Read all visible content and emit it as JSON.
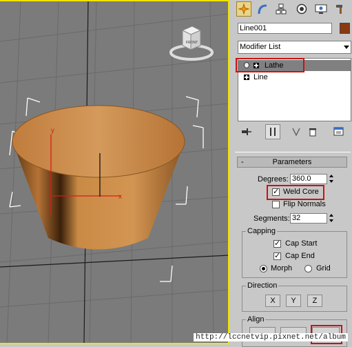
{
  "viewport": {
    "viewcube_face": "FRONT",
    "axis_y_label": "y",
    "axis_x_label": "x",
    "object_color": "#b57335",
    "border_color": "#f0e400"
  },
  "command_panel": {
    "tabs": [
      {
        "name": "create",
        "icon": "sparkle-icon"
      },
      {
        "name": "modify",
        "icon": "bend-icon"
      },
      {
        "name": "hierarchy",
        "icon": "hierarchy-icon"
      },
      {
        "name": "motion",
        "icon": "motion-icon"
      },
      {
        "name": "display",
        "icon": "display-icon"
      },
      {
        "name": "utilities",
        "icon": "hammer-icon"
      }
    ],
    "object_name": "Line001",
    "object_color": "#8a3a13",
    "modifier_list_label": "Modifier List",
    "stack": {
      "items": [
        {
          "label": "Lathe",
          "selected": true
        },
        {
          "label": "Line",
          "selected": false
        }
      ]
    }
  },
  "parameters": {
    "title": "Parameters",
    "collapse_symbol": "-",
    "degrees_label": "Degrees:",
    "degrees_value": "360.0",
    "weld_core_label": "Weld Core",
    "weld_core_checked": true,
    "flip_normals_label": "Flip Normals",
    "flip_normals_checked": false,
    "segments_label": "Segments:",
    "segments_value": "32",
    "capping": {
      "title": "Capping",
      "cap_start_label": "Cap Start",
      "cap_start_checked": true,
      "cap_end_label": "Cap End",
      "cap_end_checked": true,
      "morph_label": "Morph",
      "grid_label": "Grid",
      "selected": "Morph"
    },
    "direction": {
      "title": "Direction",
      "buttons": [
        "X",
        "Y",
        "Z"
      ]
    },
    "align": {
      "title": "Align"
    }
  },
  "watermark": "http://lccnetvip.pixnet.net/album",
  "highlight_color": "#cc1111"
}
